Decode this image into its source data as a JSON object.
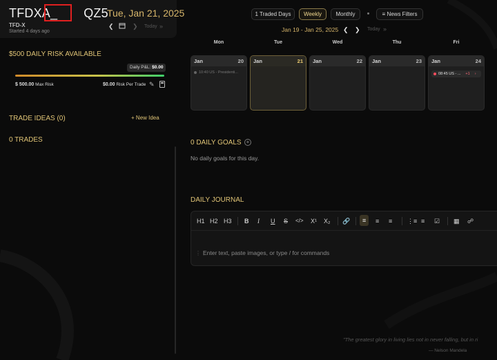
{
  "account": {
    "name_prefix": "TFDXA_",
    "name_suffix": "QZ5",
    "short_name": "TFD-X",
    "started": "Started 4 days ago",
    "date_title": "Tue, Jan 21, 2025",
    "today_label": "Today"
  },
  "risk": {
    "title": "$500 DAILY RISK AVAILABLE",
    "pnl_label": "Daily P&L:",
    "pnl_value": "$0.00",
    "max_value": "$ 500.00",
    "max_label": "Max Risk",
    "per_value": "$0.00",
    "per_label": "Risk Per Trade"
  },
  "sidebar": {
    "trade_ideas": "TRADE IDEAS (0)",
    "new_idea": "+ New Idea",
    "trades": "0 TRADES"
  },
  "toolbar": {
    "traded_days": "1 Traded Days",
    "weekly": "Weekly",
    "monthly": "Monthly",
    "news_filters": "News Filters",
    "range": "Jan 19 - Jan 25, 2025",
    "today": "Today"
  },
  "week": {
    "dows": [
      "Mon",
      "Tue",
      "Wed",
      "Thu",
      "Fri"
    ],
    "days": [
      {
        "month": "Jan",
        "num": "20",
        "event": "10:40 US - Presidenti..."
      },
      {
        "month": "Jan",
        "num": "21"
      },
      {
        "month": "Jan",
        "num": "22"
      },
      {
        "month": "Jan",
        "num": "23"
      },
      {
        "month": "Jan",
        "num": "24",
        "event": "08:45 US - ...",
        "more": "+1"
      }
    ]
  },
  "goals": {
    "title": "0 DAILY GOALS",
    "empty": "No daily goals for this day."
  },
  "journal": {
    "title": "DAILY JOURNAL",
    "placeholder": "Enter text, paste images, or type / for commands",
    "tools": {
      "h1": "H1",
      "h2": "H2",
      "h3": "H3",
      "bold": "B",
      "italic": "I",
      "underline": "U",
      "strike": "S",
      "code": "</>",
      "sup": "X¹",
      "sub": "X₂"
    }
  },
  "quote": {
    "text": "\"The greatest glory in living lies not in never falling, but in ri",
    "author": "— Nelson Mandela"
  },
  "colors": {
    "accent_gold": "#e0c476",
    "background": "#0b0b0b",
    "event_red": "#ff4d5e"
  }
}
